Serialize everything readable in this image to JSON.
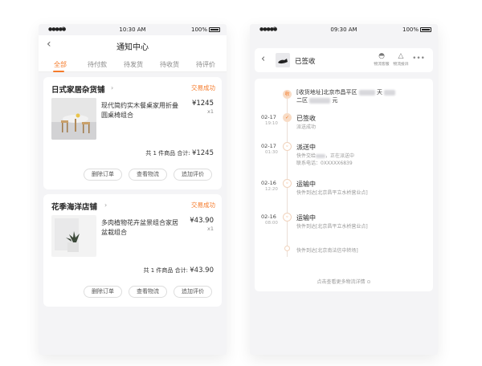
{
  "left": {
    "status": {
      "time": "10:30 AM",
      "battery": "100%"
    },
    "nav": {
      "title": "通知中心"
    },
    "tabs": [
      {
        "label": "全部",
        "active": true
      },
      {
        "label": "待付款"
      },
      {
        "label": "待发货"
      },
      {
        "label": "待收货"
      },
      {
        "label": "待评价"
      }
    ],
    "orders": [
      {
        "shop": "日式家居杂货铺",
        "status": "交易成功",
        "product": "现代简约实木餐桌家用折叠圆桌椅组合",
        "price": "¥1245",
        "qty": "x1",
        "summary_count": "共 1 件商品",
        "summary_total_label": "合计:",
        "summary_total": "¥1245",
        "buttons": [
          "删除订单",
          "查看物流",
          "追加评价"
        ]
      },
      {
        "shop": "花季海洋店铺",
        "status": "交易成功",
        "product": "多肉植物花卉盆景组合家居盆栽组合",
        "price": "¥43.90",
        "qty": "x1",
        "summary_count": "共 1 件商品",
        "summary_total_label": "合计:",
        "summary_total": "¥43.90",
        "buttons": [
          "删除订单",
          "查看物流",
          "追加评价"
        ]
      }
    ]
  },
  "right": {
    "status": {
      "time": "09:30 AM",
      "battery": "100%"
    },
    "header": {
      "title": "已签收",
      "icon_service_label": "物流客服",
      "icon_report_label": "物流投诉"
    },
    "address": {
      "prefix": "[收货地址]北京市昌平区",
      "suffix": "天",
      "line2_prefix": "二区",
      "line2_suffix": "元"
    },
    "events": [
      {
        "date": "02-17",
        "time": "19:10",
        "title": "已签收",
        "sub": "派送成功"
      },
      {
        "date": "02-17",
        "time": "01:30",
        "title": "派送中",
        "sub": "快件交给",
        "sub2": "，正在派送中",
        "sub3": "联系电话：",
        "phone": "0XXXXX6839"
      },
      {
        "date": "02-16",
        "time": "12:20",
        "title": "运输中",
        "sub": "快件到达[北京昌平立水桥营业点]"
      },
      {
        "date": "02-16",
        "time": "08:00",
        "title": "运输中",
        "sub": "快件到达[北京昌平立水桥营业点]"
      },
      {
        "sub": "快件到达[北京南法信中转场]"
      }
    ],
    "more": "点击查看更多物流详情"
  },
  "colors": {
    "accent": "#f57b2b",
    "bg": "#f4f4f6"
  }
}
